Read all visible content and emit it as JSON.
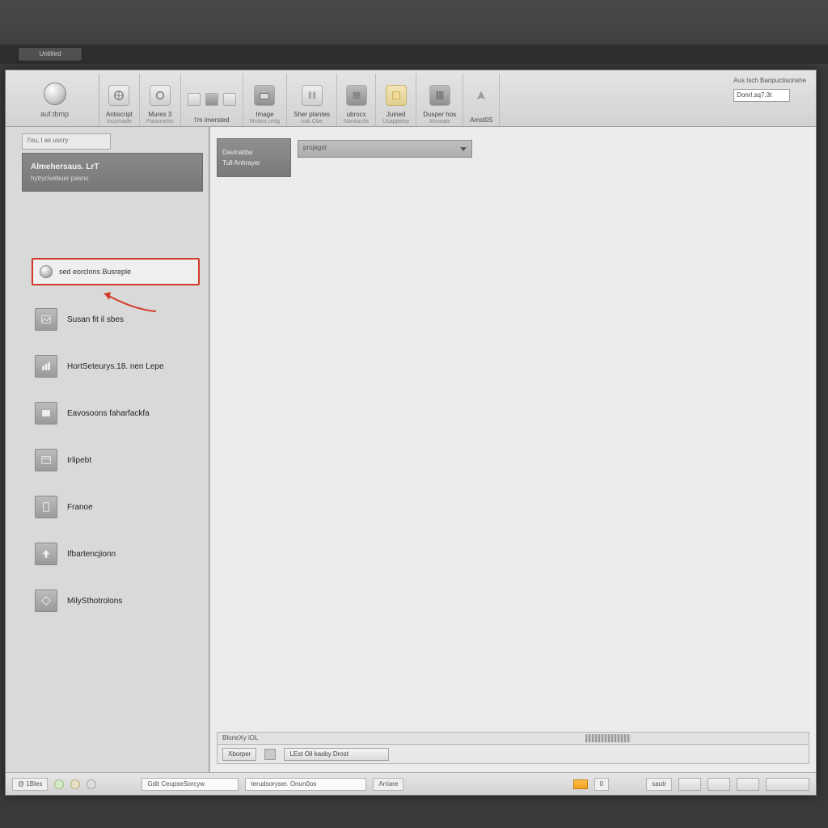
{
  "backdrop": {
    "tab_label": "Untitled"
  },
  "ribbon": {
    "orb_label": "auf.tbmp",
    "groups": [
      {
        "label1": "Antiscript",
        "label2": "Incomade"
      },
      {
        "label1": "Mures 3",
        "label2": "Parametric"
      },
      {
        "label1": "I'm imersted",
        "label2": ""
      },
      {
        "label1": "Image",
        "label2": "Motors nrdg"
      },
      {
        "label1": "Sher plantes",
        "label2": "Irak Obe"
      },
      {
        "label1": "ubrocx",
        "label2": "Nontacrlis"
      },
      {
        "label1": "Juined",
        "label2": "Usappeloy"
      },
      {
        "label1": "Dusper hos",
        "label2": "Wrosats"
      },
      {
        "label1": "Amst0S",
        "label2": ""
      }
    ],
    "right_label": "Aus Isch Banpuctisonshe",
    "right_field": "Donrl.sq7.3t"
  },
  "sidebar": {
    "tab_label": "l'ou, l as uscry",
    "head_title": "Almehersaus. LrT",
    "head_sub": "hytrycivebuer pasno",
    "highlight_label": "sed eorclons Busreple",
    "items": [
      {
        "label": "Susan fit il sbes"
      },
      {
        "label": "HortSeteurys.18. nen Lepe"
      },
      {
        "label": "Eavosoons faharfackfa"
      },
      {
        "label": "Irlipebt"
      },
      {
        "label": "Franoe"
      },
      {
        "label": "Ifbartencjionn"
      },
      {
        "label": "MilySthotrolons"
      }
    ]
  },
  "content": {
    "tab_line1": "Davinatttw",
    "tab_line2": "Tull Anhrayer",
    "dropdown_label": "projagst",
    "ruler_label": "BloneXy iOL",
    "bottom_btn1": "Xborper",
    "bottom_field": "LEst Oil kasby Drost"
  },
  "status": {
    "left_chip": "@ 1Bles",
    "field1": "Gdit CeupseSorcyw",
    "field2": "terudsoryser. Onun0os",
    "chip_done": "Arriare",
    "chip_o": "0",
    "chip_right1": "sautr"
  }
}
